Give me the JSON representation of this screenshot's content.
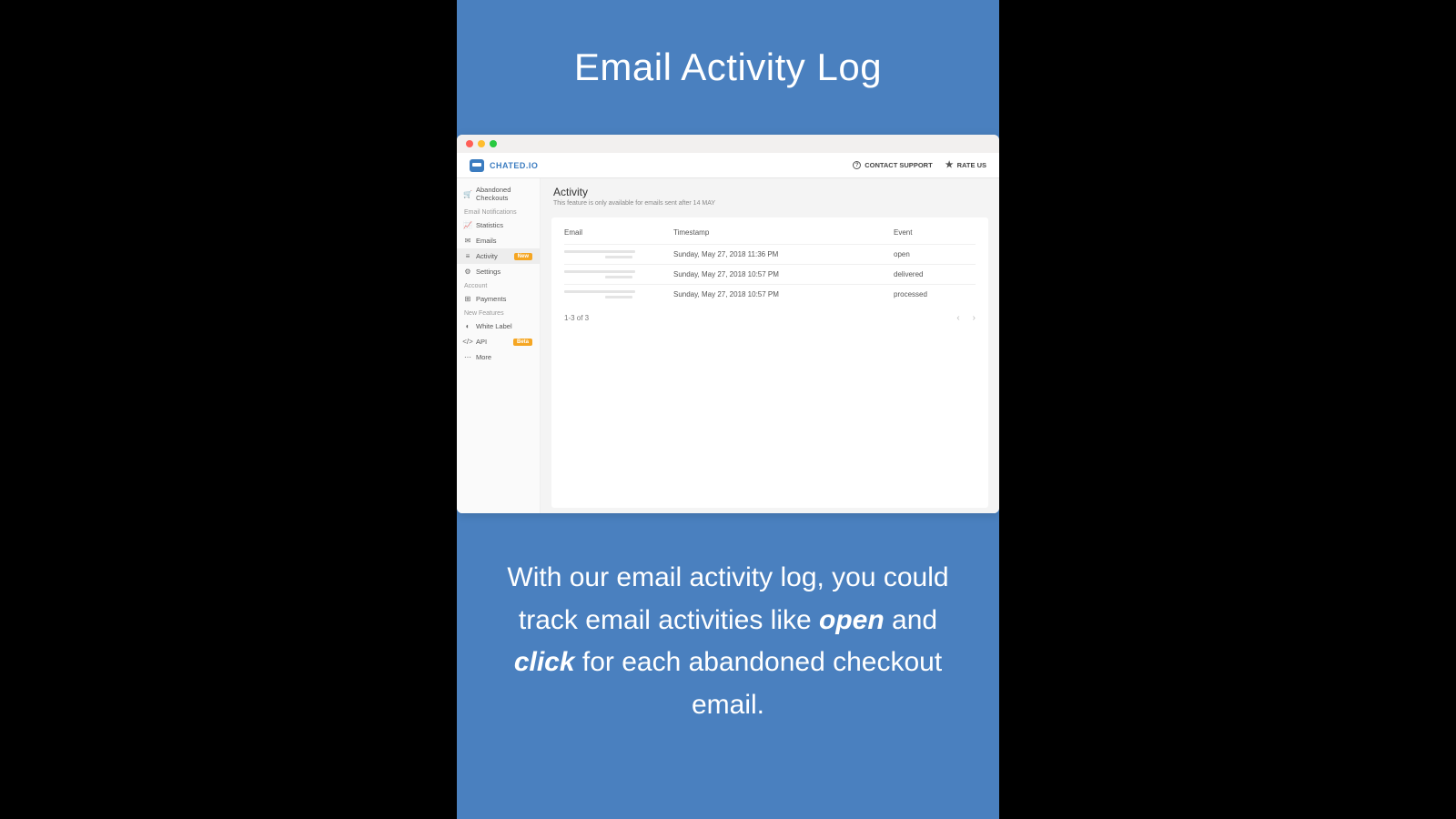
{
  "promo": {
    "title": "Email Activity Log",
    "body_pre": "With our email activity log, you could track email activities like ",
    "em1": "open",
    "mid1": " and ",
    "em2": "click",
    "body_post": " for each abandoned checkout email."
  },
  "brand": {
    "name": "CHATED.IO"
  },
  "topbar": {
    "support": "CONTACT SUPPORT",
    "rate": "RATE US"
  },
  "sidebar": {
    "items": [
      {
        "icon": "🛒",
        "label": "Abandoned Checkouts"
      }
    ],
    "section_email": "Email Notifications",
    "email_items": [
      {
        "icon": "📈",
        "label": "Statistics",
        "badge": ""
      },
      {
        "icon": "✉",
        "label": "Emails",
        "badge": ""
      },
      {
        "icon": "≡",
        "label": "Activity",
        "badge": "New",
        "active": true
      },
      {
        "icon": "⚙",
        "label": "Settings",
        "badge": ""
      }
    ],
    "section_account": "Account",
    "account_items": [
      {
        "icon": "⊞",
        "label": "Payments"
      }
    ],
    "section_new": "New Features",
    "new_items": [
      {
        "icon": "◐",
        "label": "White Label",
        "badge": ""
      },
      {
        "icon": "</>",
        "label": "API",
        "badge": "Beta"
      },
      {
        "icon": "⋯",
        "label": "More",
        "badge": ""
      }
    ]
  },
  "content": {
    "title": "Activity",
    "note": "This feature is only available for emails sent after 14 MAY",
    "headers": {
      "email": "Email",
      "timestamp": "Timestamp",
      "event": "Event"
    },
    "rows": [
      {
        "timestamp": "Sunday, May 27, 2018 11:36 PM",
        "event": "open"
      },
      {
        "timestamp": "Sunday, May 27, 2018 10:57 PM",
        "event": "delivered"
      },
      {
        "timestamp": "Sunday, May 27, 2018 10:57 PM",
        "event": "processed"
      }
    ],
    "footer": "1-3 of 3",
    "pager": {
      "prev": "‹",
      "next": "›"
    }
  }
}
